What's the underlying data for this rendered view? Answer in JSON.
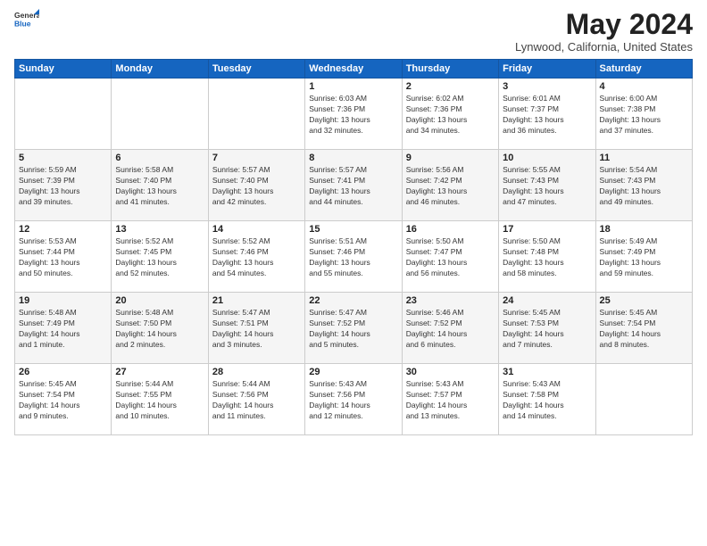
{
  "logo": {
    "line1": "General",
    "line2": "Blue"
  },
  "title": "May 2024",
  "location": "Lynwood, California, United States",
  "weekdays": [
    "Sunday",
    "Monday",
    "Tuesday",
    "Wednesday",
    "Thursday",
    "Friday",
    "Saturday"
  ],
  "weeks": [
    [
      {
        "day": "",
        "info": ""
      },
      {
        "day": "",
        "info": ""
      },
      {
        "day": "",
        "info": ""
      },
      {
        "day": "1",
        "info": "Sunrise: 6:03 AM\nSunset: 7:36 PM\nDaylight: 13 hours\nand 32 minutes."
      },
      {
        "day": "2",
        "info": "Sunrise: 6:02 AM\nSunset: 7:36 PM\nDaylight: 13 hours\nand 34 minutes."
      },
      {
        "day": "3",
        "info": "Sunrise: 6:01 AM\nSunset: 7:37 PM\nDaylight: 13 hours\nand 36 minutes."
      },
      {
        "day": "4",
        "info": "Sunrise: 6:00 AM\nSunset: 7:38 PM\nDaylight: 13 hours\nand 37 minutes."
      }
    ],
    [
      {
        "day": "5",
        "info": "Sunrise: 5:59 AM\nSunset: 7:39 PM\nDaylight: 13 hours\nand 39 minutes."
      },
      {
        "day": "6",
        "info": "Sunrise: 5:58 AM\nSunset: 7:40 PM\nDaylight: 13 hours\nand 41 minutes."
      },
      {
        "day": "7",
        "info": "Sunrise: 5:57 AM\nSunset: 7:40 PM\nDaylight: 13 hours\nand 42 minutes."
      },
      {
        "day": "8",
        "info": "Sunrise: 5:57 AM\nSunset: 7:41 PM\nDaylight: 13 hours\nand 44 minutes."
      },
      {
        "day": "9",
        "info": "Sunrise: 5:56 AM\nSunset: 7:42 PM\nDaylight: 13 hours\nand 46 minutes."
      },
      {
        "day": "10",
        "info": "Sunrise: 5:55 AM\nSunset: 7:43 PM\nDaylight: 13 hours\nand 47 minutes."
      },
      {
        "day": "11",
        "info": "Sunrise: 5:54 AM\nSunset: 7:43 PM\nDaylight: 13 hours\nand 49 minutes."
      }
    ],
    [
      {
        "day": "12",
        "info": "Sunrise: 5:53 AM\nSunset: 7:44 PM\nDaylight: 13 hours\nand 50 minutes."
      },
      {
        "day": "13",
        "info": "Sunrise: 5:52 AM\nSunset: 7:45 PM\nDaylight: 13 hours\nand 52 minutes."
      },
      {
        "day": "14",
        "info": "Sunrise: 5:52 AM\nSunset: 7:46 PM\nDaylight: 13 hours\nand 54 minutes."
      },
      {
        "day": "15",
        "info": "Sunrise: 5:51 AM\nSunset: 7:46 PM\nDaylight: 13 hours\nand 55 minutes."
      },
      {
        "day": "16",
        "info": "Sunrise: 5:50 AM\nSunset: 7:47 PM\nDaylight: 13 hours\nand 56 minutes."
      },
      {
        "day": "17",
        "info": "Sunrise: 5:50 AM\nSunset: 7:48 PM\nDaylight: 13 hours\nand 58 minutes."
      },
      {
        "day": "18",
        "info": "Sunrise: 5:49 AM\nSunset: 7:49 PM\nDaylight: 13 hours\nand 59 minutes."
      }
    ],
    [
      {
        "day": "19",
        "info": "Sunrise: 5:48 AM\nSunset: 7:49 PM\nDaylight: 14 hours\nand 1 minute."
      },
      {
        "day": "20",
        "info": "Sunrise: 5:48 AM\nSunset: 7:50 PM\nDaylight: 14 hours\nand 2 minutes."
      },
      {
        "day": "21",
        "info": "Sunrise: 5:47 AM\nSunset: 7:51 PM\nDaylight: 14 hours\nand 3 minutes."
      },
      {
        "day": "22",
        "info": "Sunrise: 5:47 AM\nSunset: 7:52 PM\nDaylight: 14 hours\nand 5 minutes."
      },
      {
        "day": "23",
        "info": "Sunrise: 5:46 AM\nSunset: 7:52 PM\nDaylight: 14 hours\nand 6 minutes."
      },
      {
        "day": "24",
        "info": "Sunrise: 5:45 AM\nSunset: 7:53 PM\nDaylight: 14 hours\nand 7 minutes."
      },
      {
        "day": "25",
        "info": "Sunrise: 5:45 AM\nSunset: 7:54 PM\nDaylight: 14 hours\nand 8 minutes."
      }
    ],
    [
      {
        "day": "26",
        "info": "Sunrise: 5:45 AM\nSunset: 7:54 PM\nDaylight: 14 hours\nand 9 minutes."
      },
      {
        "day": "27",
        "info": "Sunrise: 5:44 AM\nSunset: 7:55 PM\nDaylight: 14 hours\nand 10 minutes."
      },
      {
        "day": "28",
        "info": "Sunrise: 5:44 AM\nSunset: 7:56 PM\nDaylight: 14 hours\nand 11 minutes."
      },
      {
        "day": "29",
        "info": "Sunrise: 5:43 AM\nSunset: 7:56 PM\nDaylight: 14 hours\nand 12 minutes."
      },
      {
        "day": "30",
        "info": "Sunrise: 5:43 AM\nSunset: 7:57 PM\nDaylight: 14 hours\nand 13 minutes."
      },
      {
        "day": "31",
        "info": "Sunrise: 5:43 AM\nSunset: 7:58 PM\nDaylight: 14 hours\nand 14 minutes."
      },
      {
        "day": "",
        "info": ""
      }
    ]
  ]
}
